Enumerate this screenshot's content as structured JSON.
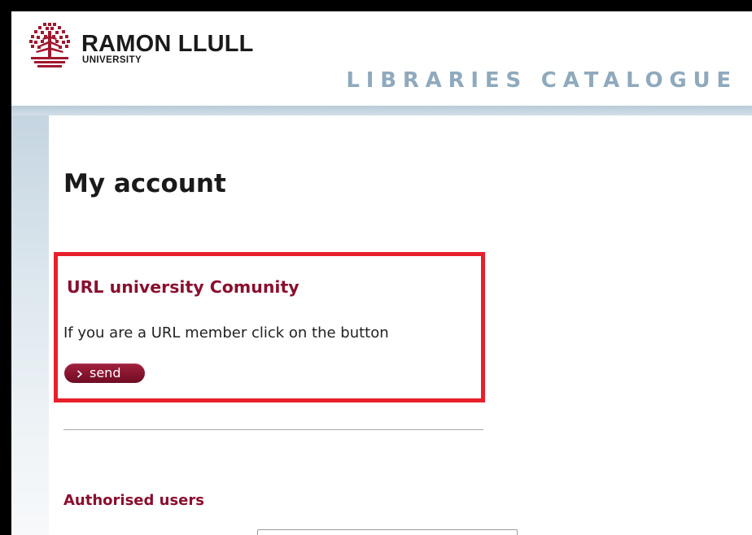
{
  "header": {
    "logo": {
      "name": "RAMON LLULL",
      "subtitle": "UNIVERSITY",
      "icon": "tree-logo-icon",
      "color": "#a0182f"
    },
    "catalogue_title": "LIBRARIES CATALOGUE"
  },
  "main": {
    "page_title": "My account",
    "community": {
      "title": "URL university Comunity",
      "text": "If you are a URL member click on the button",
      "button_label": "send",
      "button_icon": "chevron-right-icon"
    },
    "authorised": {
      "title": "Authorised users",
      "input_value": ""
    }
  },
  "colors": {
    "accent": "#8a0f2e",
    "highlight_border": "#e8202a",
    "catalogue_title": "#8fa9bd"
  }
}
